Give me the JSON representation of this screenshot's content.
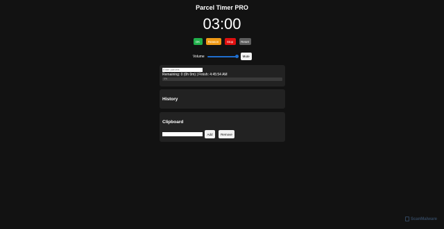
{
  "app": {
    "title": "Parcel Timer PRO"
  },
  "timer": {
    "display": "03:00"
  },
  "controls": {
    "ok_label": "OK",
    "reason_label": "Reason",
    "stop_label": "Stop",
    "reset_label": "Reset"
  },
  "volume": {
    "label": "Volume",
    "level": 1.0,
    "mute_label": "Mute"
  },
  "parcels": {
    "placeholder": "Enter parcels",
    "remaining_text": "Remaining: 0 (0h 0m) | Finish: 4:45:54 AM",
    "progress_text": "0%",
    "progress": 0
  },
  "history": {
    "heading": "History"
  },
  "clipboard": {
    "heading": "Clipboard",
    "input_value": "",
    "add_label": "Add",
    "remove_label": "Remove"
  },
  "watermark": {
    "text": "ScanMalware"
  },
  "colors": {
    "background": "#121212",
    "card": "#222222",
    "ok": "#21b04b",
    "reason": "#f09a16",
    "stop": "#e01010",
    "reset": "#5e5e5e",
    "slider": "#1f6fd0"
  }
}
